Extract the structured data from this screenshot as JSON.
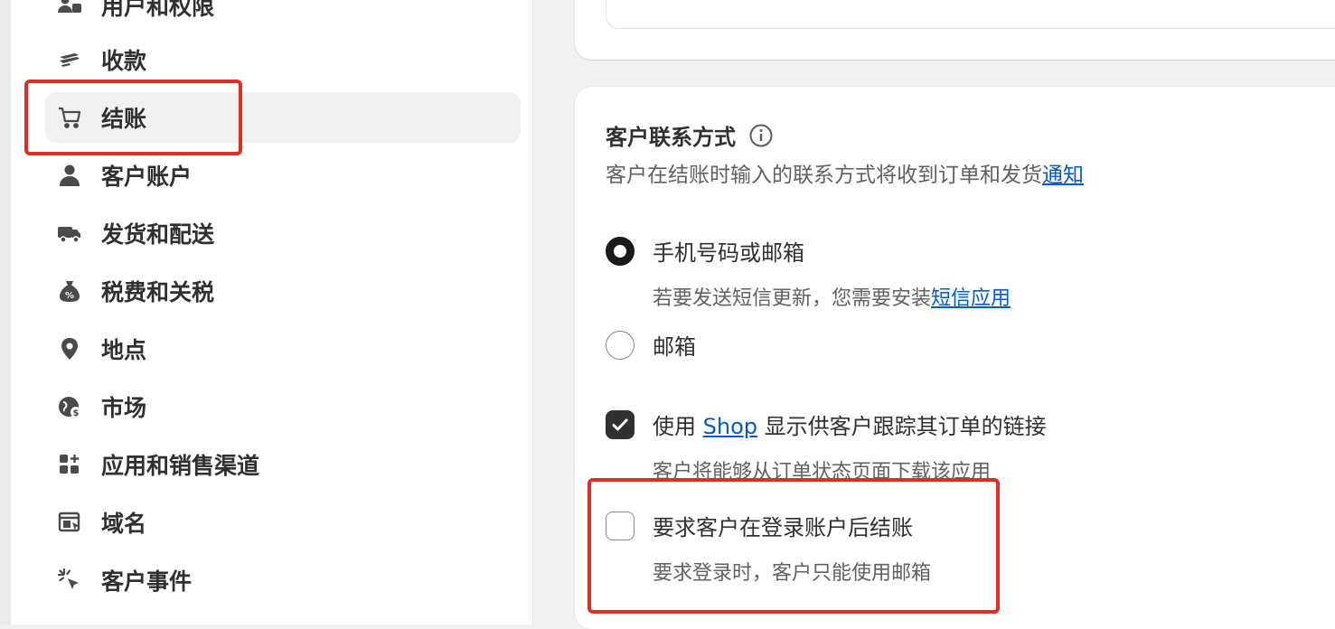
{
  "sidebar": {
    "items": [
      {
        "label": "用户和权限",
        "icon": "users-icon"
      },
      {
        "label": "收款",
        "icon": "payment-icon"
      },
      {
        "label": "结账",
        "icon": "cart-icon",
        "active": true
      },
      {
        "label": "客户账户",
        "icon": "person-icon"
      },
      {
        "label": "发货和配送",
        "icon": "truck-icon"
      },
      {
        "label": "税费和关税",
        "icon": "tax-bag-icon"
      },
      {
        "label": "地点",
        "icon": "location-pin-icon"
      },
      {
        "label": "市场",
        "icon": "globe-icon"
      },
      {
        "label": "应用和销售渠道",
        "icon": "apps-icon"
      },
      {
        "label": "域名",
        "icon": "domain-icon"
      },
      {
        "label": "客户事件",
        "icon": "cursor-click-icon"
      }
    ]
  },
  "contact": {
    "title": "客户联系方式",
    "desc_prefix": "客户在结账时输入的联系方式将收到订单和发货",
    "desc_link": "通知",
    "option_phone_or_email": "手机号码或邮箱",
    "option_phone_help_prefix": "若要发送短信更新，您需要安装",
    "option_phone_help_link": "短信应用",
    "option_email": "邮箱",
    "shop_prefix": "使用 ",
    "shop_link": "Shop",
    "shop_suffix": " 显示供客户跟踪其订单的链接",
    "shop_help": "客户将能够从订单状态页面下载该应用",
    "require_login": "要求客户在登录账户后结账",
    "require_login_help": "要求登录时，客户只能使用邮箱"
  },
  "colors": {
    "accent_link": "#005bd3",
    "highlight_box": "#e02d24",
    "checked_fill": "#303030"
  }
}
